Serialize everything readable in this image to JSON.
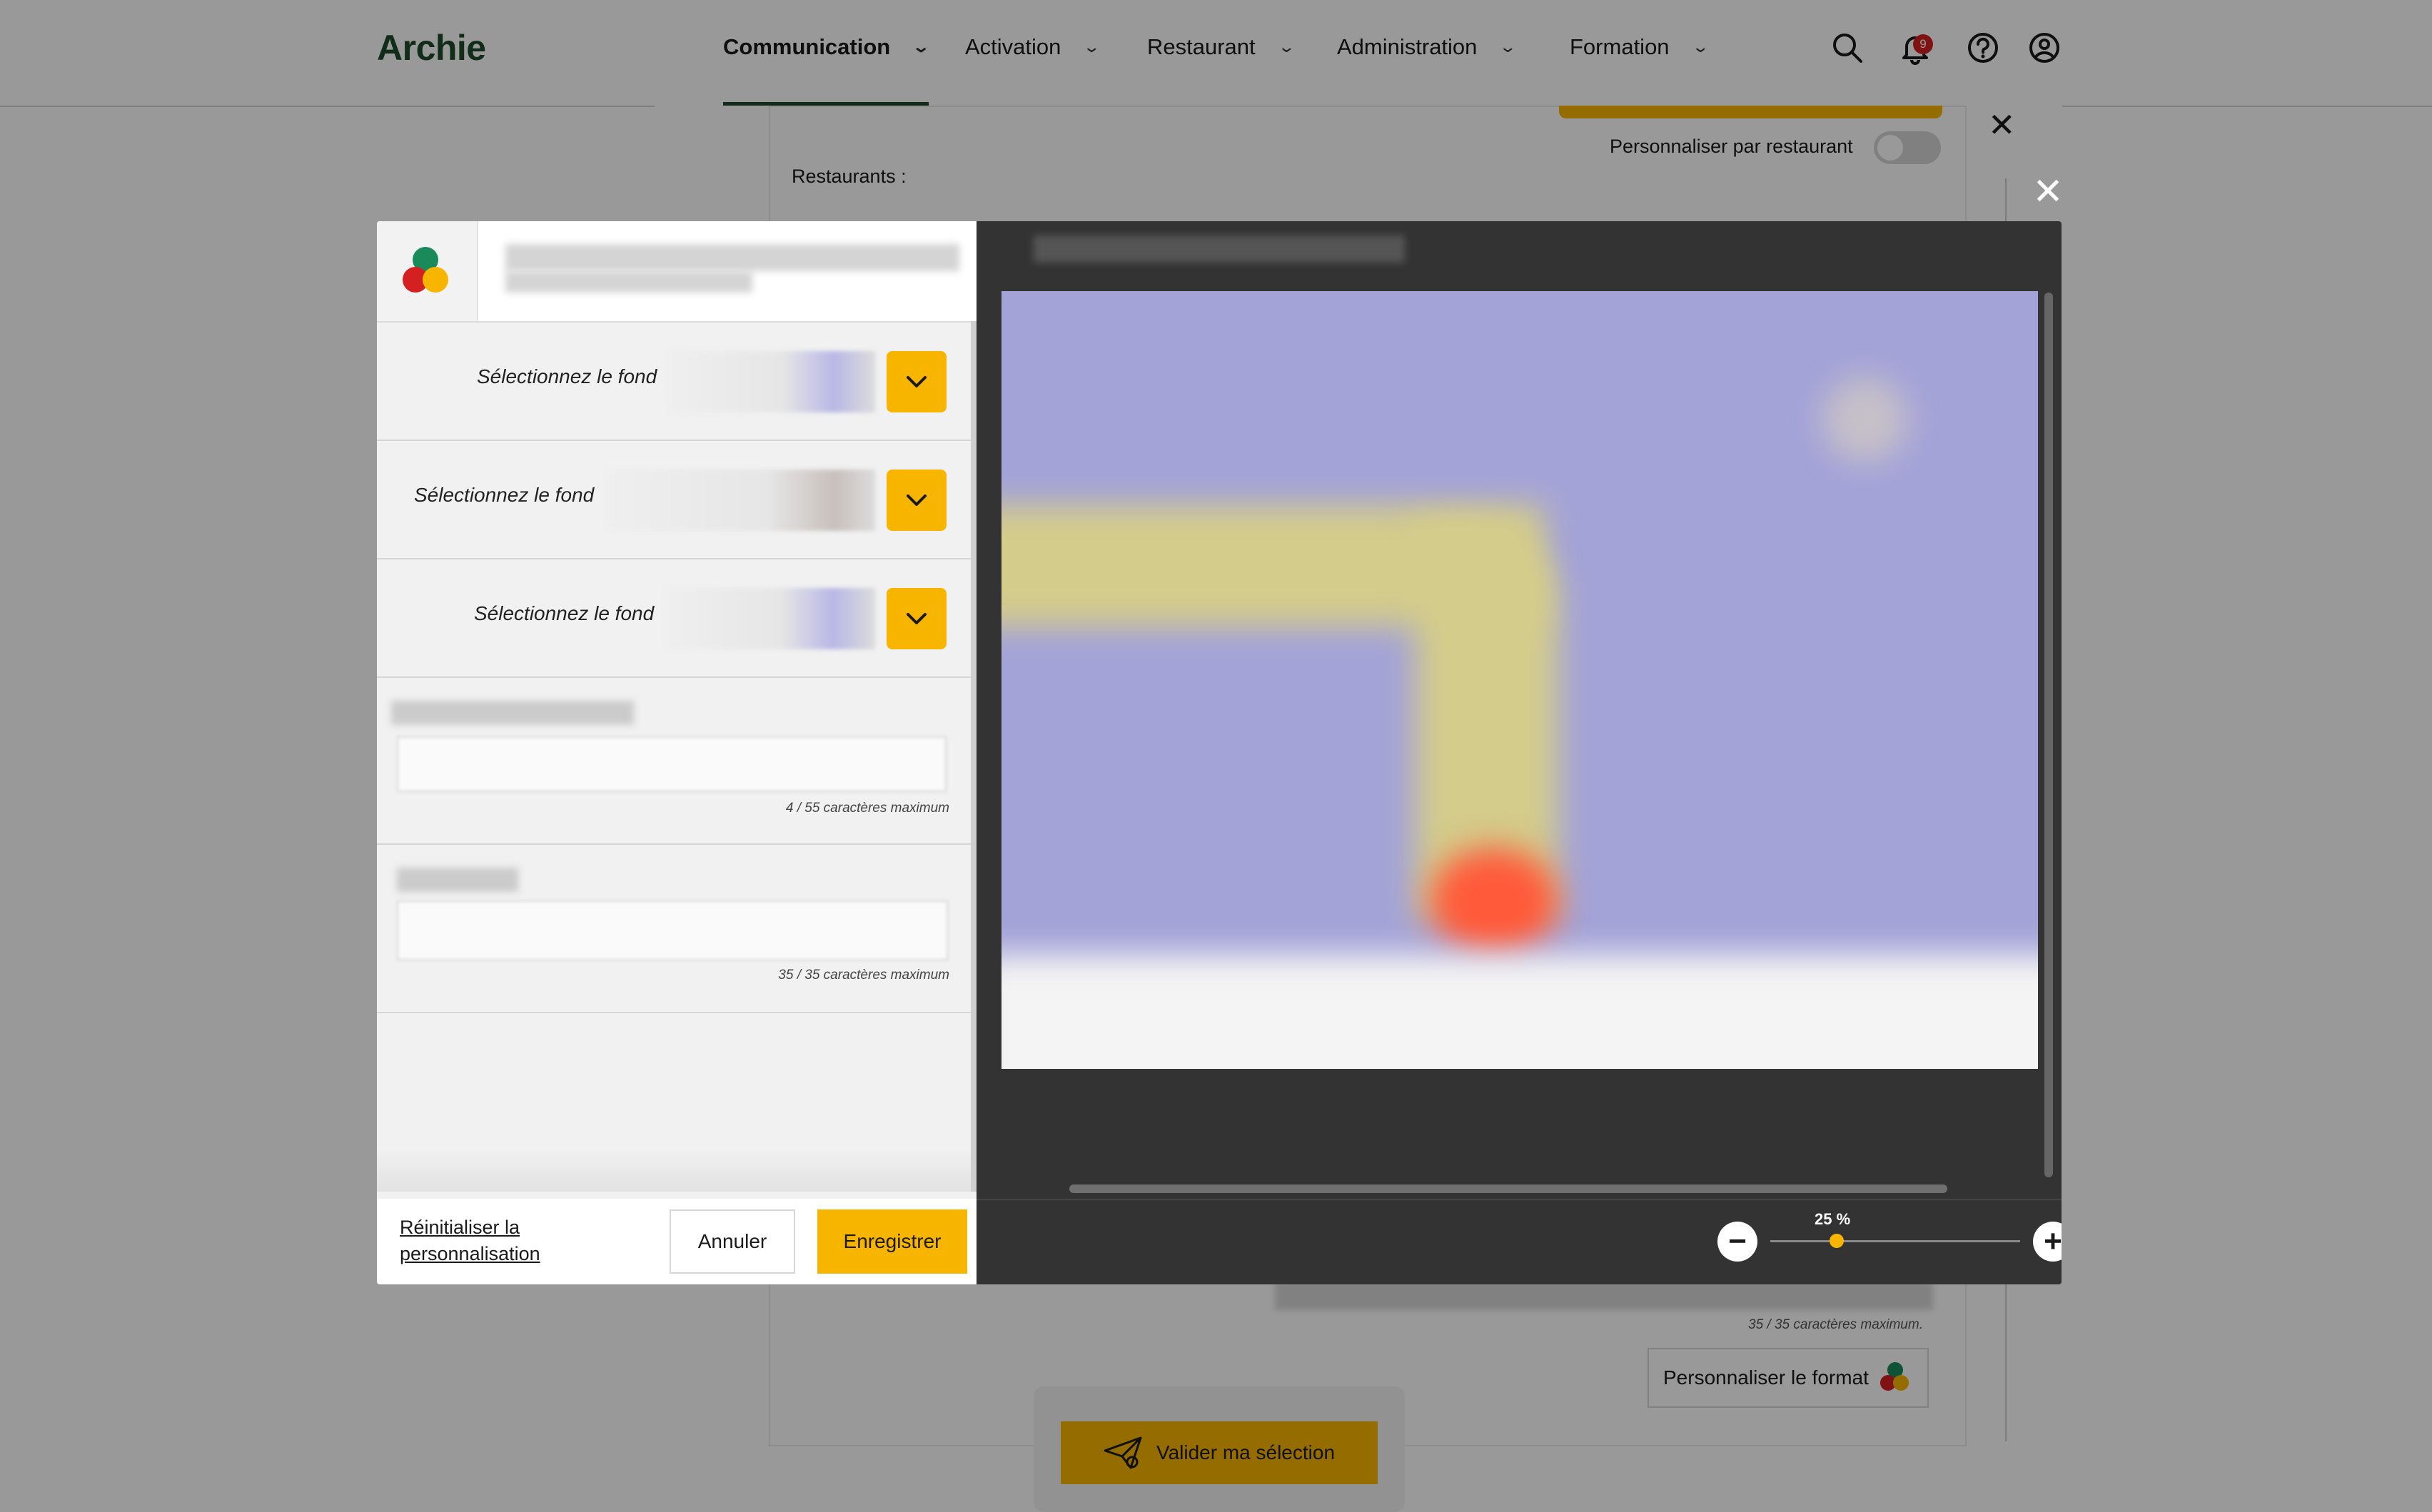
{
  "app": {
    "title": "Archie"
  },
  "nav": {
    "items": [
      {
        "label": "Communication"
      },
      {
        "label": "Activation"
      },
      {
        "label": "Restaurant"
      },
      {
        "label": "Administration"
      },
      {
        "label": "Formation"
      }
    ],
    "notification_count": "9",
    "icons": [
      "search-icon",
      "bell-icon",
      "help-icon",
      "user-icon"
    ]
  },
  "background_form": {
    "personalize_by_restaurant_label": "Personnaliser par restaurant",
    "restaurants_label": "Restaurants :",
    "bottom_char_count": "35 / 35 caractères maximum.",
    "personalize_format_label": "Personnaliser le format",
    "validate_button": "Valider ma sélection"
  },
  "editor": {
    "fond_rows": [
      {
        "label": "Sélectionnez le fond"
      },
      {
        "label": "Sélectionnez le fond"
      },
      {
        "label": "Sélectionnez le fond"
      }
    ],
    "text_fields": [
      {
        "char_count": "4 / 55 caractères maximum"
      },
      {
        "char_count": "35 / 35 caractères maximum"
      }
    ],
    "reset_link": "Réinitialiser la personnalisation",
    "cancel_button": "Annuler",
    "save_button": "Enregistrer"
  },
  "zoom": {
    "value": 25,
    "label": "25 %"
  },
  "colors": {
    "accent": "#f7b500",
    "brand_green": "#1f4a2c",
    "preview_bg": "#a4a3d8",
    "notification_red": "#d42020"
  }
}
